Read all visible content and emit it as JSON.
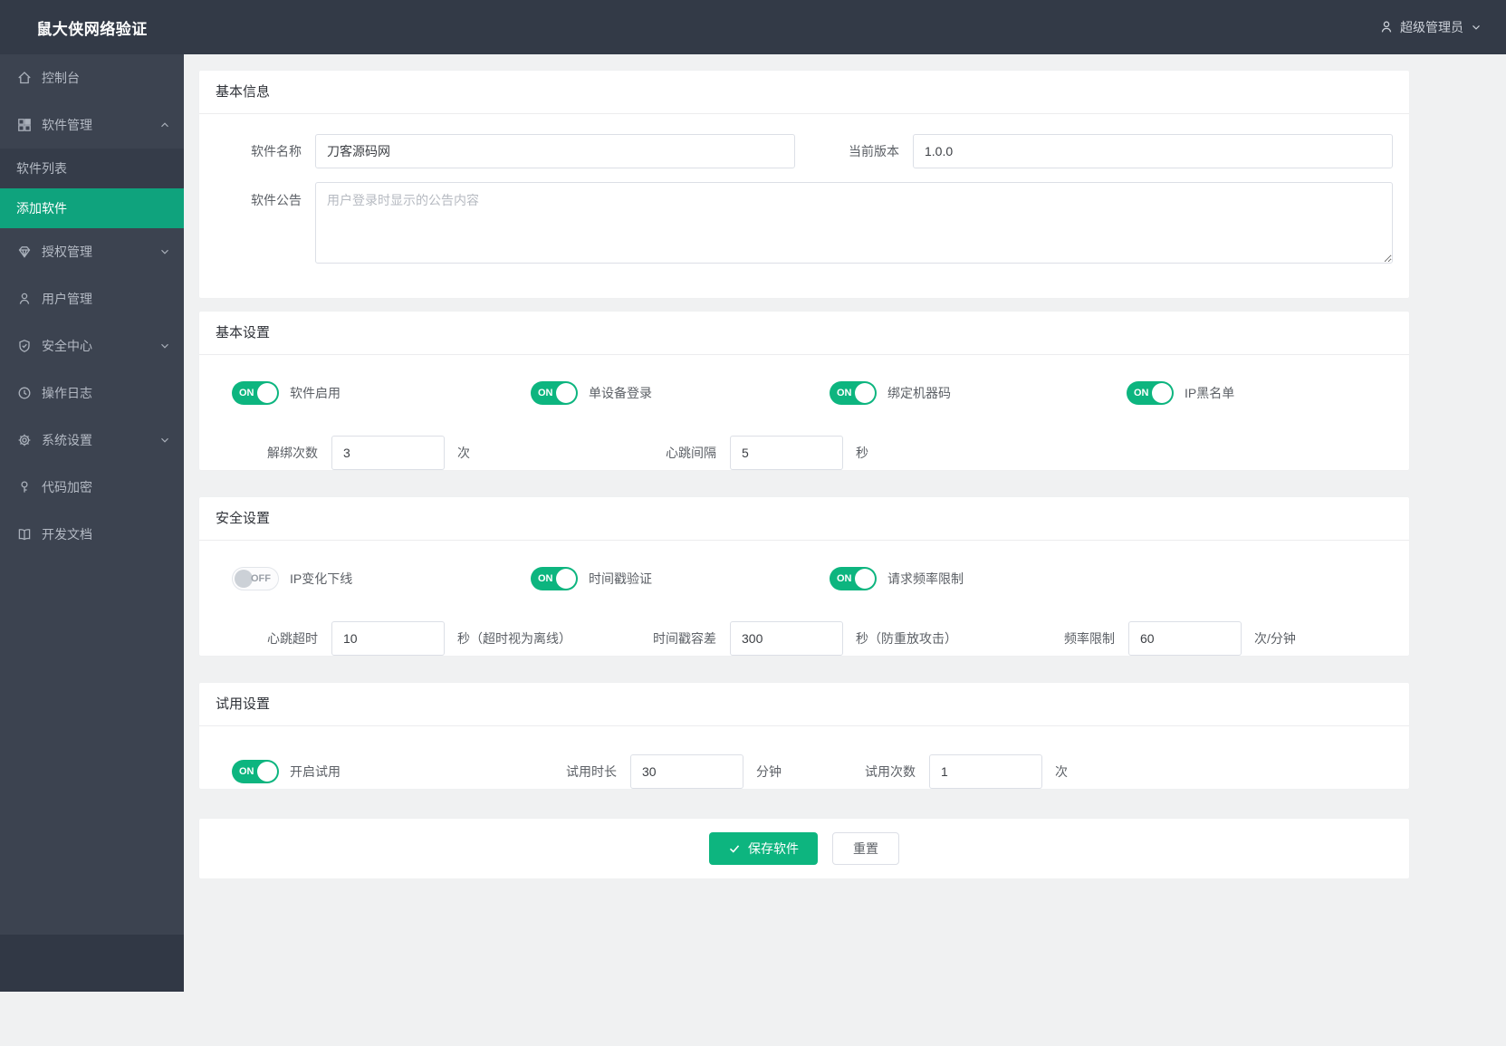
{
  "app": {
    "title": "鼠大侠网络验证"
  },
  "header": {
    "user": "超级管理员"
  },
  "sidebar": {
    "items": [
      {
        "label": "控制台"
      },
      {
        "label": "软件管理"
      },
      {
        "label": "软件列表"
      },
      {
        "label": "添加软件"
      },
      {
        "label": "授权管理"
      },
      {
        "label": "用户管理"
      },
      {
        "label": "安全中心"
      },
      {
        "label": "操作日志"
      },
      {
        "label": "系统设置"
      },
      {
        "label": "代码加密"
      },
      {
        "label": "开发文档"
      }
    ]
  },
  "sections": {
    "basic_info": {
      "title": "基本信息",
      "software_name_label": "软件名称",
      "software_name_value": "刀客源码网",
      "version_label": "当前版本",
      "version_value": "1.0.0",
      "notice_label": "软件公告",
      "notice_placeholder": "用户登录时显示的公告内容"
    },
    "basic_settings": {
      "title": "基本设置",
      "toggles": [
        {
          "label": "软件启用",
          "state": "ON"
        },
        {
          "label": "单设备登录",
          "state": "ON"
        },
        {
          "label": "绑定机器码",
          "state": "ON"
        },
        {
          "label": "IP黑名单",
          "state": "ON"
        }
      ],
      "fields": [
        {
          "label": "解绑次数",
          "value": "3",
          "unit": "次"
        },
        {
          "label": "心跳间隔",
          "value": "5",
          "unit": "秒"
        }
      ]
    },
    "security_settings": {
      "title": "安全设置",
      "toggles": [
        {
          "label": "IP变化下线",
          "state": "OFF"
        },
        {
          "label": "时间戳验证",
          "state": "ON"
        },
        {
          "label": "请求频率限制",
          "state": "ON"
        }
      ],
      "fields": [
        {
          "label": "心跳超时",
          "value": "10",
          "unit": "秒（超时视为离线）"
        },
        {
          "label": "时间戳容差",
          "value": "300",
          "unit": "秒（防重放攻击）"
        },
        {
          "label": "频率限制",
          "value": "60",
          "unit": "次/分钟"
        }
      ]
    },
    "trial_settings": {
      "title": "试用设置",
      "toggle": {
        "label": "开启试用",
        "state": "ON"
      },
      "fields": [
        {
          "label": "试用时长",
          "value": "30",
          "unit": "分钟"
        },
        {
          "label": "试用次数",
          "value": "1",
          "unit": "次"
        }
      ]
    }
  },
  "actions": {
    "save": "保存软件",
    "reset": "重置"
  },
  "colors": {
    "accent": "#0db57f",
    "sidebar_active": "#0fa37d",
    "topbar": "#333a47"
  }
}
